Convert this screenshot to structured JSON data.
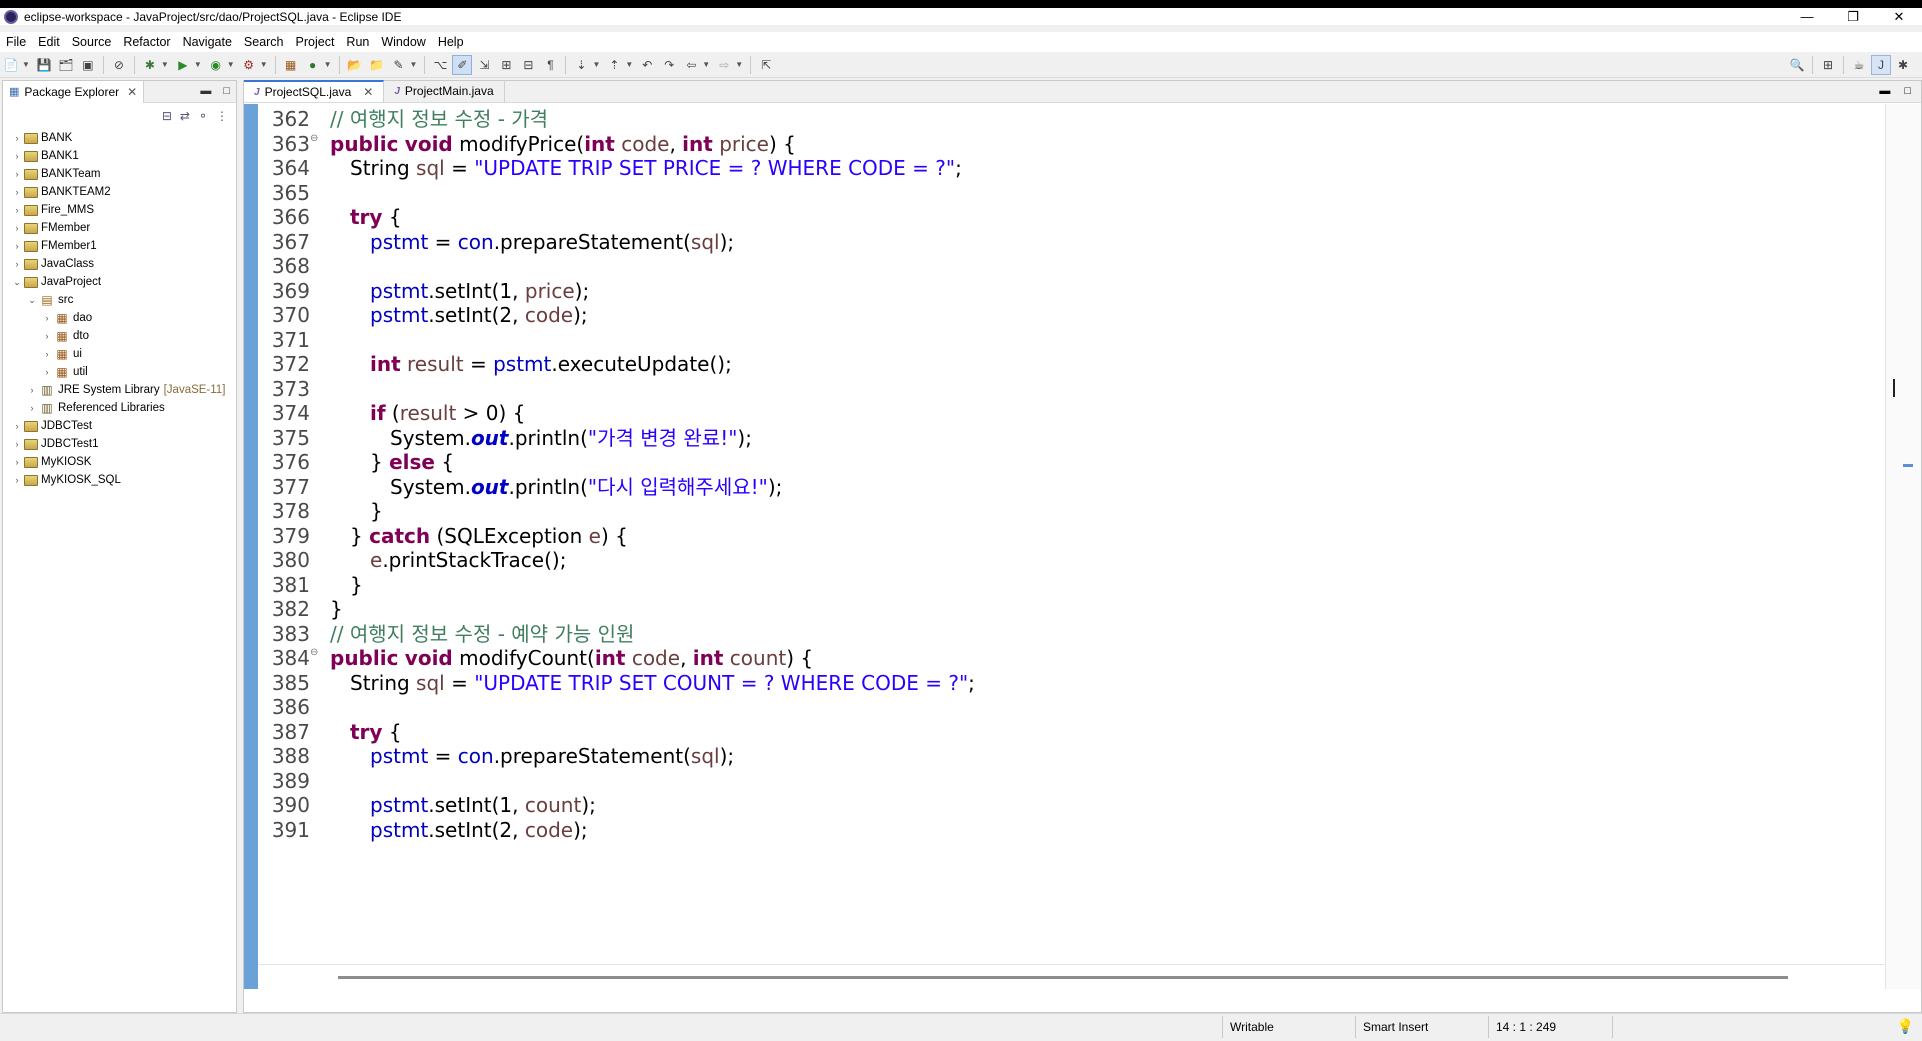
{
  "window": {
    "title": "eclipse-workspace - JavaProject/src/dao/ProjectSQL.java - Eclipse IDE",
    "minimize": "—",
    "restore": "❐",
    "close": "✕"
  },
  "menu": [
    "File",
    "Edit",
    "Source",
    "Refactor",
    "Navigate",
    "Search",
    "Project",
    "Run",
    "Window",
    "Help"
  ],
  "package_explorer": {
    "title": "Package Explorer",
    "tree": [
      {
        "label": "BANK",
        "indent": 0,
        "twisty": ">",
        "icon": "project"
      },
      {
        "label": "BANK1",
        "indent": 0,
        "twisty": ">",
        "icon": "project"
      },
      {
        "label": "BANKTeam",
        "indent": 0,
        "twisty": ">",
        "icon": "project"
      },
      {
        "label": "BANKTEAM2",
        "indent": 0,
        "twisty": ">",
        "icon": "project"
      },
      {
        "label": "Fire_MMS",
        "indent": 0,
        "twisty": ">",
        "icon": "project"
      },
      {
        "label": "FMember",
        "indent": 0,
        "twisty": ">",
        "icon": "project"
      },
      {
        "label": "FMember1",
        "indent": 0,
        "twisty": ">",
        "icon": "project"
      },
      {
        "label": "JavaClass",
        "indent": 0,
        "twisty": ">",
        "icon": "project"
      },
      {
        "label": "JavaProject",
        "indent": 0,
        "twisty": "v",
        "icon": "project"
      },
      {
        "label": "src",
        "indent": 1,
        "twisty": "v",
        "icon": "source-folder"
      },
      {
        "label": "dao",
        "indent": 2,
        "twisty": ">",
        "icon": "package"
      },
      {
        "label": "dto",
        "indent": 2,
        "twisty": ">",
        "icon": "package"
      },
      {
        "label": "ui",
        "indent": 2,
        "twisty": ">",
        "icon": "package"
      },
      {
        "label": "util",
        "indent": 2,
        "twisty": ">",
        "icon": "package"
      },
      {
        "label": "JRE System Library",
        "decor": "[JavaSE-11]",
        "indent": 1,
        "twisty": ">",
        "icon": "library"
      },
      {
        "label": "Referenced Libraries",
        "indent": 1,
        "twisty": ">",
        "icon": "library"
      },
      {
        "label": "JDBCTest",
        "indent": 0,
        "twisty": ">",
        "icon": "project"
      },
      {
        "label": "JDBCTest1",
        "indent": 0,
        "twisty": ">",
        "icon": "project"
      },
      {
        "label": "MyKIOSK",
        "indent": 0,
        "twisty": ">",
        "icon": "project"
      },
      {
        "label": "MyKIOSK_SQL",
        "indent": 0,
        "twisty": ">",
        "icon": "project"
      }
    ]
  },
  "editor": {
    "tabs": [
      {
        "label": "ProjectSQL.java",
        "active": true
      },
      {
        "label": "ProjectMain.java",
        "active": false
      }
    ],
    "lines": [
      {
        "n": "362",
        "indent": 0,
        "tokens": [
          [
            "cm",
            "// 여행지 정보 수정 - 가격"
          ]
        ]
      },
      {
        "n": "363",
        "fold": true,
        "indent": 0,
        "tokens": [
          [
            "kw",
            "public"
          ],
          [
            "",
            " "
          ],
          [
            "kw",
            "void"
          ],
          [
            "",
            " modifyPrice("
          ],
          [
            "kw",
            "int"
          ],
          [
            "",
            " "
          ],
          [
            "var",
            "code"
          ],
          [
            "",
            ", "
          ],
          [
            "kw",
            "int"
          ],
          [
            "",
            " "
          ],
          [
            "var",
            "price"
          ],
          [
            "",
            ") {"
          ]
        ]
      },
      {
        "n": "364",
        "indent": 1,
        "tokens": [
          [
            "",
            "String "
          ],
          [
            "var",
            "sql"
          ],
          [
            "",
            " = "
          ],
          [
            "str",
            "\"UPDATE TRIP SET PRICE = ? WHERE CODE = ?\""
          ],
          [
            "",
            ";"
          ]
        ]
      },
      {
        "n": "365",
        "indent": 0,
        "tokens": []
      },
      {
        "n": "366",
        "indent": 1,
        "tokens": [
          [
            "kw",
            "try"
          ],
          [
            "",
            " {"
          ]
        ]
      },
      {
        "n": "367",
        "indent": 2,
        "tokens": [
          [
            "fld",
            "pstmt"
          ],
          [
            "",
            " = "
          ],
          [
            "fld",
            "con"
          ],
          [
            "",
            ".prepareStatement("
          ],
          [
            "var",
            "sql"
          ],
          [
            "",
            ");"
          ]
        ]
      },
      {
        "n": "368",
        "indent": 0,
        "tokens": []
      },
      {
        "n": "369",
        "indent": 2,
        "tokens": [
          [
            "fld",
            "pstmt"
          ],
          [
            "",
            ".setInt(1, "
          ],
          [
            "var",
            "price"
          ],
          [
            "",
            ");"
          ]
        ]
      },
      {
        "n": "370",
        "indent": 2,
        "tokens": [
          [
            "fld",
            "pstmt"
          ],
          [
            "",
            ".setInt(2, "
          ],
          [
            "var",
            "code"
          ],
          [
            "",
            ");"
          ]
        ]
      },
      {
        "n": "371",
        "indent": 0,
        "tokens": []
      },
      {
        "n": "372",
        "indent": 2,
        "tokens": [
          [
            "kw",
            "int"
          ],
          [
            "",
            " "
          ],
          [
            "var",
            "result"
          ],
          [
            "",
            " = "
          ],
          [
            "fld",
            "pstmt"
          ],
          [
            "",
            ".executeUpdate();"
          ]
        ]
      },
      {
        "n": "373",
        "indent": 0,
        "tokens": []
      },
      {
        "n": "374",
        "indent": 2,
        "tokens": [
          [
            "kw",
            "if"
          ],
          [
            "",
            " ("
          ],
          [
            "var",
            "result"
          ],
          [
            "",
            " > 0) {"
          ]
        ]
      },
      {
        "n": "375",
        "indent": 3,
        "tokens": [
          [
            "",
            "System."
          ],
          [
            "sfld",
            "out"
          ],
          [
            "",
            ".println("
          ],
          [
            "str",
            "\"가격 변경 완료!\""
          ],
          [
            "",
            ");"
          ]
        ]
      },
      {
        "n": "376",
        "indent": 2,
        "tokens": [
          [
            "",
            "} "
          ],
          [
            "kw",
            "else"
          ],
          [
            "",
            " {"
          ]
        ]
      },
      {
        "n": "377",
        "indent": 3,
        "tokens": [
          [
            "",
            "System."
          ],
          [
            "sfld",
            "out"
          ],
          [
            "",
            ".println("
          ],
          [
            "str",
            "\"다시 입력해주세요!\""
          ],
          [
            "",
            ");"
          ]
        ]
      },
      {
        "n": "378",
        "indent": 2,
        "tokens": [
          [
            "",
            "}"
          ]
        ]
      },
      {
        "n": "379",
        "indent": 1,
        "tokens": [
          [
            "",
            "} "
          ],
          [
            "kw",
            "catch"
          ],
          [
            "",
            " (SQLException "
          ],
          [
            "var",
            "e"
          ],
          [
            "",
            ") {"
          ]
        ]
      },
      {
        "n": "380",
        "indent": 2,
        "tokens": [
          [
            "var",
            "e"
          ],
          [
            "",
            ".printStackTrace();"
          ]
        ]
      },
      {
        "n": "381",
        "indent": 1,
        "tokens": [
          [
            "",
            "}"
          ]
        ]
      },
      {
        "n": "382",
        "indent": 0,
        "tokens": [
          [
            "",
            "}"
          ]
        ]
      },
      {
        "n": "383",
        "indent": 0,
        "tokens": [
          [
            "cm",
            "// 여행지 정보 수정 - 예약 가능 인원"
          ]
        ]
      },
      {
        "n": "384",
        "fold": true,
        "indent": 0,
        "tokens": [
          [
            "kw",
            "public"
          ],
          [
            "",
            " "
          ],
          [
            "kw",
            "void"
          ],
          [
            "",
            " modifyCount("
          ],
          [
            "kw",
            "int"
          ],
          [
            "",
            " "
          ],
          [
            "var",
            "code"
          ],
          [
            "",
            ", "
          ],
          [
            "kw",
            "int"
          ],
          [
            "",
            " "
          ],
          [
            "var",
            "count"
          ],
          [
            "",
            ") {"
          ]
        ]
      },
      {
        "n": "385",
        "indent": 1,
        "tokens": [
          [
            "",
            "String "
          ],
          [
            "var",
            "sql"
          ],
          [
            "",
            " = "
          ],
          [
            "str",
            "\"UPDATE TRIP SET COUNT = ? WHERE CODE = ?\""
          ],
          [
            "",
            ";"
          ]
        ]
      },
      {
        "n": "386",
        "indent": 0,
        "tokens": []
      },
      {
        "n": "387",
        "indent": 1,
        "tokens": [
          [
            "kw",
            "try"
          ],
          [
            "",
            " {"
          ]
        ]
      },
      {
        "n": "388",
        "indent": 2,
        "tokens": [
          [
            "fld",
            "pstmt"
          ],
          [
            "",
            " = "
          ],
          [
            "fld",
            "con"
          ],
          [
            "",
            ".prepareStatement("
          ],
          [
            "var",
            "sql"
          ],
          [
            "",
            ");"
          ]
        ]
      },
      {
        "n": "389",
        "indent": 0,
        "tokens": []
      },
      {
        "n": "390",
        "indent": 2,
        "tokens": [
          [
            "fld",
            "pstmt"
          ],
          [
            "",
            ".setInt(1, "
          ],
          [
            "var",
            "count"
          ],
          [
            "",
            ");"
          ]
        ]
      },
      {
        "n": "391",
        "indent": 2,
        "tokens": [
          [
            "fld",
            "pstmt"
          ],
          [
            "",
            ".setInt(2, "
          ],
          [
            "var",
            "code"
          ],
          [
            "",
            ");"
          ]
        ]
      }
    ]
  },
  "status": {
    "writable": "Writable",
    "insert_mode": "Smart Insert",
    "position": "14 : 1 : 249"
  }
}
